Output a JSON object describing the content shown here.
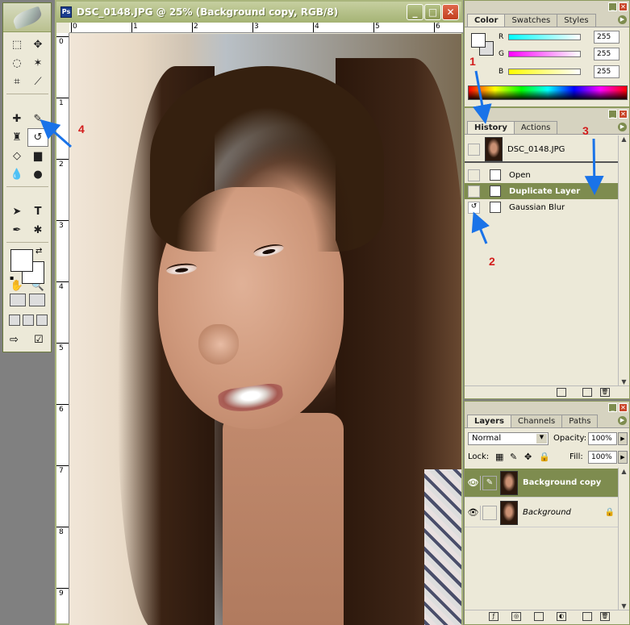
{
  "document": {
    "title": "DSC_0148.JPG @ 25% (Background copy, RGB/8)",
    "ruler_top": [
      "0",
      "1",
      "2",
      "3",
      "4",
      "5",
      "6"
    ],
    "ruler_left": [
      "0",
      "1",
      "2",
      "3",
      "4",
      "5",
      "6",
      "7",
      "8",
      "9"
    ]
  },
  "window_buttons": {
    "minimize": "_",
    "maximize": "□",
    "close": "✕"
  },
  "color_panel": {
    "tabs": [
      "Color",
      "Swatches",
      "Styles"
    ],
    "r_label": "R",
    "g_label": "G",
    "b_label": "B",
    "r_value": "255",
    "g_value": "255",
    "b_value": "255"
  },
  "history_panel": {
    "tabs": [
      "History",
      "Actions"
    ],
    "snapshot": "DSC_0148.JPG",
    "steps": [
      "Open",
      "Duplicate Layer",
      "Gaussian Blur"
    ]
  },
  "layers_panel": {
    "tabs": [
      "Layers",
      "Channels",
      "Paths"
    ],
    "blend_mode": "Normal",
    "opacity_label": "Opacity:",
    "opacity_value": "100%",
    "lock_label": "Lock:",
    "fill_label": "Fill:",
    "fill_value": "100%",
    "layers": [
      "Background copy",
      "Background"
    ]
  },
  "annotations": [
    "1",
    "2",
    "3",
    "4"
  ],
  "colors": {
    "accent": "#7e8c4f",
    "arrow": "#1a73e8",
    "annotation": "#d31c1c"
  }
}
